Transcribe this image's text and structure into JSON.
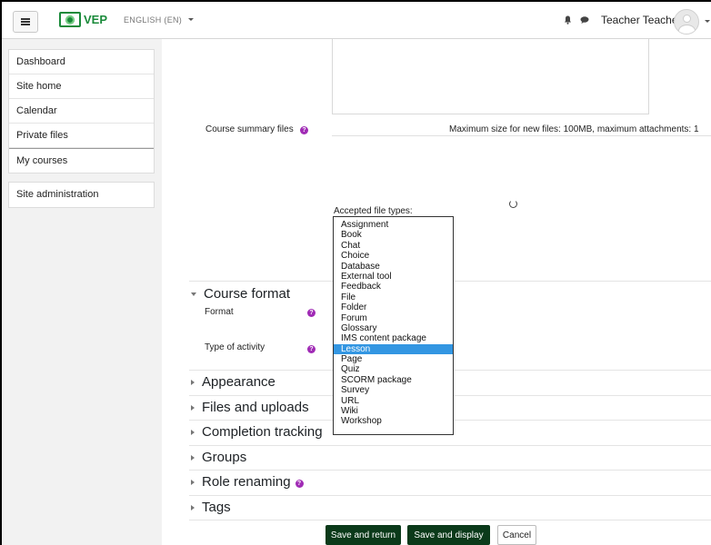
{
  "navbar": {
    "brand": "VEP",
    "language": "ENGLISH (EN)",
    "user_name": "Teacher Teacher"
  },
  "drawer": {
    "group1": [
      "Dashboard",
      "Site home",
      "Calendar",
      "Private files"
    ],
    "current": "My courses",
    "group2": [
      "Site administration"
    ]
  },
  "form": {
    "summary_files_label": "Course summary files",
    "max_size_text": "Maximum size for new files: 100MB, maximum attachments: 1",
    "accepted_types": "Accepted file types:",
    "course_format_title": "Course format",
    "format_label": "Format",
    "type_of_activity_label": "Type of activity",
    "sections": [
      "Appearance",
      "Files and uploads",
      "Completion tracking",
      "Groups",
      "Role renaming",
      "Tags"
    ]
  },
  "activity_options": [
    "Assignment",
    "Book",
    "Chat",
    "Choice",
    "Database",
    "External tool",
    "Feedback",
    "File",
    "Folder",
    "Forum",
    "Glossary",
    "IMS content package",
    "Lesson",
    "Page",
    "Quiz",
    "SCORM package",
    "Survey",
    "URL",
    "Wiki",
    "Workshop"
  ],
  "selected_option": "Lesson",
  "buttons": {
    "save_return": "Save and return",
    "save_display": "Save and display",
    "cancel": "Cancel"
  },
  "colors": {
    "brand": "#1a8a3a",
    "primary_button": "#0b3a1a",
    "help_icon": "#a02bb5",
    "selection": "#3396e2"
  }
}
